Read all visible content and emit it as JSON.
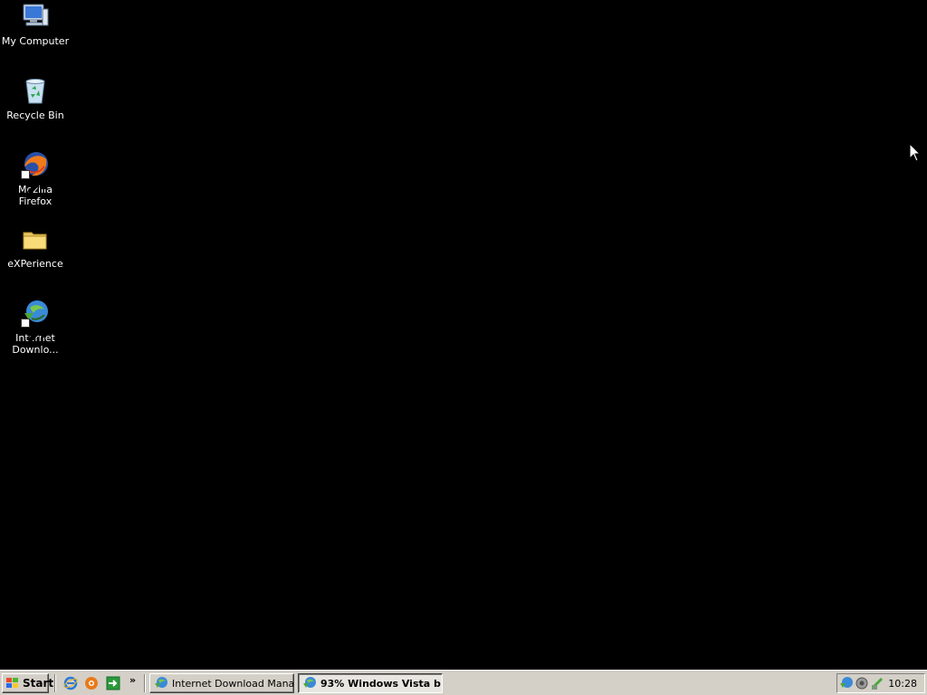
{
  "desktop": {
    "background_color": "#000000",
    "icons": [
      {
        "label": "My Computer",
        "icon": "my-computer-icon"
      },
      {
        "label": "Recycle Bin",
        "icon": "recycle-bin-icon"
      },
      {
        "label": "Mozilla Firefox",
        "icon": "firefox-icon"
      },
      {
        "label": "eXPerience",
        "icon": "folder-icon"
      },
      {
        "label": "Internet Downlo...",
        "icon": "internet-download-manager-icon"
      }
    ]
  },
  "taskbar": {
    "start_label": "Start",
    "quick_launch": [
      {
        "icon": "internet-explorer-icon"
      },
      {
        "icon": "browser-orange-icon"
      },
      {
        "icon": "show-desktop-arrow-icon"
      }
    ],
    "chevron": "»",
    "tasks": [
      {
        "label": "Internet Download Mana...",
        "icon": "internet-download-manager-icon",
        "active": false
      },
      {
        "label": "93% Windows Vista b...",
        "icon": "internet-download-manager-icon",
        "active": true
      }
    ],
    "tray": {
      "icons": [
        "idm-tray-icon",
        "speaker-tray-icon",
        "network-tray-icon"
      ],
      "clock": "10:28"
    }
  }
}
